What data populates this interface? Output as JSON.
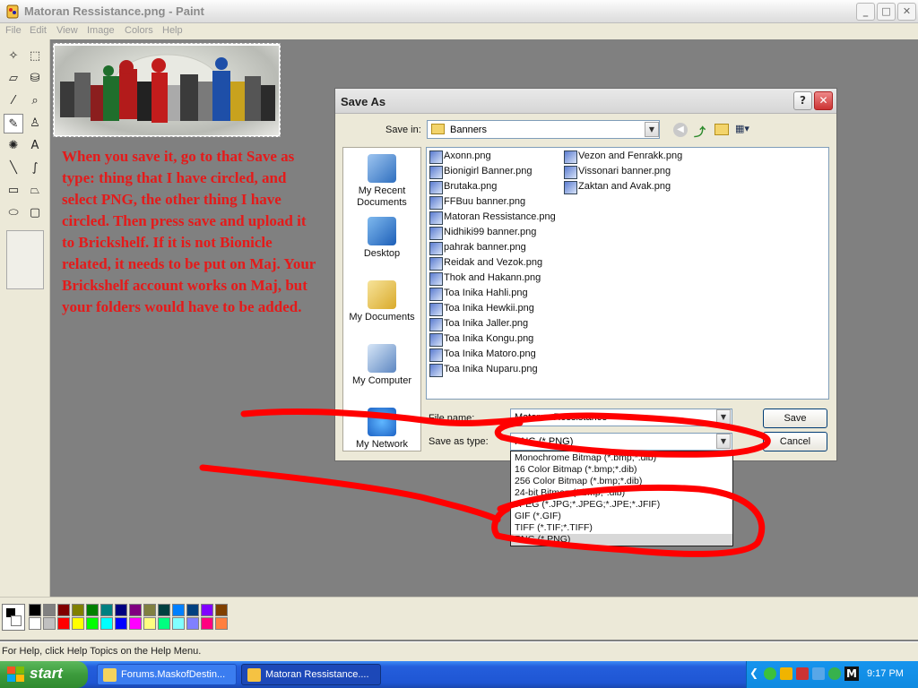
{
  "window": {
    "title": "Matoran Ressistance.png - Paint",
    "minimize": "_",
    "maximize": "□",
    "close": "✕"
  },
  "menu": [
    "File",
    "Edit",
    "View",
    "Image",
    "Colors",
    "Help"
  ],
  "tools": [
    {
      "icon": "free-select-icon",
      "glyph": "✧"
    },
    {
      "icon": "select-icon",
      "glyph": "⬚"
    },
    {
      "icon": "eraser-icon",
      "glyph": "▱"
    },
    {
      "icon": "fill-icon",
      "glyph": "⛁"
    },
    {
      "icon": "color-picker-icon",
      "glyph": "⁄"
    },
    {
      "icon": "magnifier-icon",
      "glyph": "⌕"
    },
    {
      "icon": "pencil-icon",
      "glyph": "✎"
    },
    {
      "icon": "brush-icon",
      "glyph": "♙"
    },
    {
      "icon": "airbrush-icon",
      "glyph": "✺"
    },
    {
      "icon": "text-icon",
      "glyph": "A"
    },
    {
      "icon": "line-icon",
      "glyph": "╲"
    },
    {
      "icon": "curve-icon",
      "glyph": "∫"
    },
    {
      "icon": "rectangle-icon",
      "glyph": "▭"
    },
    {
      "icon": "polygon-icon",
      "glyph": "⏢"
    },
    {
      "icon": "ellipse-icon",
      "glyph": "⬭"
    },
    {
      "icon": "rounded-rect-icon",
      "glyph": "▢"
    }
  ],
  "canvas": {
    "note": "When you save it, go to that Save as type: thing that I have circled, and select PNG, the other thing I have circled. Then press save and upload it to Brickshelf. If it is not Bionicle related, it needs to be put on Maj. Your Brickshelf account works on Maj, but your folders would have to be added."
  },
  "palette": {
    "colors_top": [
      "#000000",
      "#808080",
      "#800000",
      "#808000",
      "#008000",
      "#008080",
      "#000080",
      "#800080",
      "#808040",
      "#004040",
      "#0080ff",
      "#004080",
      "#8000ff",
      "#804000"
    ],
    "colors_bottom": [
      "#ffffff",
      "#c0c0c0",
      "#ff0000",
      "#ffff00",
      "#00ff00",
      "#00ffff",
      "#0000ff",
      "#ff00ff",
      "#ffff80",
      "#00ff80",
      "#80ffff",
      "#8080ff",
      "#ff0080",
      "#ff8040"
    ]
  },
  "status": "For Help, click Help Topics on the Help Menu.",
  "taskbar": {
    "start": "start",
    "tasks": [
      "Forums.MaskofDestin...",
      "Matoran Ressistance...."
    ],
    "clock": "9:17 PM"
  },
  "dialog": {
    "title": "Save As",
    "help": "?",
    "close": "✕",
    "save_in_label": "Save in:",
    "save_in_value": "Banners",
    "places": [
      "My Recent Documents",
      "Desktop",
      "My Documents",
      "My Computer",
      "My Network"
    ],
    "files_col1": [
      "Axonn.png",
      "Bionigirl Banner.png",
      "Brutaka.png",
      "FFBuu banner.png",
      "Matoran Ressistance.png",
      "Nidhiki99 banner.png",
      "pahrak banner.png",
      "Reidak and Vezok.png",
      "Thok and Hakann.png",
      "Toa Inika Hahli.png",
      "Toa Inika Hewkii.png",
      "Toa Inika Jaller.png",
      "Toa Inika Kongu.png",
      "Toa Inika Matoro.png",
      "Toa Inika Nuparu.png"
    ],
    "files_col2": [
      "Vezon and Fenrakk.png",
      "Vissonari banner.png",
      "Zaktan and Avak.png"
    ],
    "file_name_label": "File name:",
    "file_name_value": "Matoran Ressistance",
    "save_type_label": "Save as type:",
    "save_type_value": "PNG (*.PNG)",
    "save_button": "Save",
    "cancel_button": "Cancel",
    "type_options": [
      "Monochrome Bitmap (*.bmp;*.dib)",
      "16 Color Bitmap (*.bmp;*.dib)",
      "256 Color Bitmap (*.bmp;*.dib)",
      "24-bit Bitmap (*.bmp;*.dib)",
      "JPEG (*.JPG;*.JPEG;*.JPE;*.JFIF)",
      "GIF (*.GIF)",
      "TIFF (*.TIF;*.TIFF)",
      "PNG (*.PNG)"
    ],
    "selected_option_index": 7
  },
  "annotation_color": "#ff0000"
}
